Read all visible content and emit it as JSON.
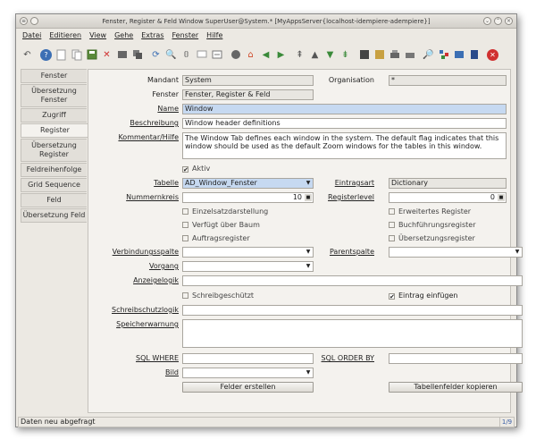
{
  "window": {
    "title": "Fenster, Register & Feld  Window  SuperUser@System.* [MyAppsServer{localhost-idempiere-adempiere}]"
  },
  "menu": [
    "Datei",
    "Editieren",
    "View",
    "Gehe",
    "Extras",
    "Fenster",
    "Hilfe"
  ],
  "tabs": [
    "Fenster",
    "Übersetzung Fenster",
    "Zugriff",
    "Register",
    "Übersetzung Register",
    "Feldreihenfolge",
    "Grid Sequence",
    "Feld",
    "Übersetzung Feld"
  ],
  "form": {
    "mandant_label": "Mandant",
    "mandant_value": "System",
    "organisation_label": "Organisation",
    "organisation_value": "*",
    "fenster_label": "Fenster",
    "fenster_value": "Fenster, Register & Feld",
    "name_label": "Name",
    "name_value": "Window",
    "beschreibung_label": "Beschreibung",
    "beschreibung_value": "Window header definitions",
    "kommentar_label": "Kommentar/Hilfe",
    "kommentar_value": "The Window Tab defines each window in the system. The default flag indicates that this window should be used as the default Zoom windows for the tables in this window.",
    "aktiv_label": "Aktiv",
    "tabelle_label": "Tabelle",
    "tabelle_value": "AD_Window_Fenster",
    "eintragsart_label": "Eintragsart",
    "eintragsart_value": "Dictionary",
    "nummernkreis_label": "Nummernkreis",
    "nummernkreis_value": "10",
    "registerlevel_label": "Registerlevel",
    "registerlevel_value": "0",
    "einzelsatz_label": "Einzelsatzdarstellung",
    "erweitertes_label": "Erweitertes Register",
    "verfuegt_label": "Verfügt über Baum",
    "buchfuehrung_label": "Buchführungsregister",
    "auftrags_label": "Auftragsregister",
    "uebersetzungs_label": "Übersetzungsregister",
    "verbindungsspalte_label": "Verbindungsspalte",
    "parentspalte_label": "Parentspalte",
    "vorgang_label": "Vorgang",
    "anzeigelogik_label": "Anzeigelogik",
    "schreibgeschuetzt_label": "Schreibgeschützt",
    "eintrag_label": "Eintrag einfügen",
    "schreibschutzlogik_label": "Schreibschutzlogik",
    "speicherwarnung_label": "Speicherwarnung",
    "sqlwhere_label": "SQL WHERE",
    "sqlorder_label": "SQL ORDER BY",
    "bild_label": "Bild",
    "felder_button": "Felder erstellen",
    "tabellenfelder_button": "Tabellenfelder kopieren"
  },
  "status": {
    "text": "Daten neu abgefragt",
    "pager": "1/9"
  }
}
